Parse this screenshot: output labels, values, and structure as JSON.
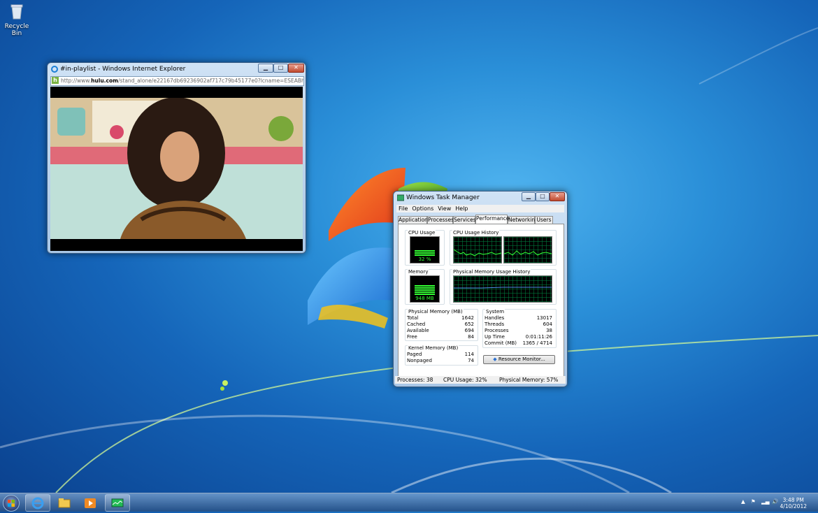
{
  "desktop": {
    "icons": [
      {
        "label": "Recycle Bin",
        "icon": "recycle-bin-icon"
      }
    ]
  },
  "ie_window": {
    "title": "#in-playlist - Windows Internet Explorer",
    "address_url_prefix": "http://www.",
    "address_url_domain": "hulu.com",
    "address_url_rest": "/stand_alone/e22167db69236902af717c79b45177e0?lcname=ESEABhVwb3BvdXRUaW",
    "site_icon": "h",
    "controls": {
      "minimize": "▁",
      "maximize": "□",
      "close": "✕"
    }
  },
  "task_manager": {
    "title": "Windows Task Manager",
    "menu": [
      "File",
      "Options",
      "View",
      "Help"
    ],
    "tabs": [
      "Applications",
      "Processes",
      "Services",
      "Performance",
      "Networking",
      "Users"
    ],
    "active_tab": "Performance",
    "cpu_usage_label": "CPU Usage",
    "cpu_usage_value": "32 %",
    "cpu_history_label": "CPU Usage History",
    "memory_label": "Memory",
    "memory_value": "948 MB",
    "mem_history_label": "Physical Memory Usage History",
    "physical_memory": {
      "title": "Physical Memory (MB)",
      "rows": [
        {
          "label": "Total",
          "value": "1642"
        },
        {
          "label": "Cached",
          "value": "652"
        },
        {
          "label": "Available",
          "value": "694"
        },
        {
          "label": "Free",
          "value": "84"
        }
      ]
    },
    "kernel_memory": {
      "title": "Kernel Memory (MB)",
      "rows": [
        {
          "label": "Paged",
          "value": "114"
        },
        {
          "label": "Nonpaged",
          "value": "74"
        }
      ]
    },
    "system": {
      "title": "System",
      "rows": [
        {
          "label": "Handles",
          "value": "13017"
        },
        {
          "label": "Threads",
          "value": "604"
        },
        {
          "label": "Processes",
          "value": "38"
        },
        {
          "label": "Up Time",
          "value": "0:01:11:26"
        },
        {
          "label": "Commit (MB)",
          "value": "1365 / 4714"
        }
      ]
    },
    "resource_monitor_button": "Resource Monitor...",
    "status": {
      "processes": "Processes: 38",
      "cpu": "CPU Usage: 32%",
      "memory": "Physical Memory: 57%"
    },
    "cpu_usage_fraction": 0.32,
    "memory_usage_fraction": 0.57
  },
  "taskbar": {
    "pinned": [
      "internet-explorer-icon",
      "windows-explorer-icon",
      "media-player-icon",
      "task-manager-icon"
    ],
    "tray_icons": [
      "show-hidden-icons-icon",
      "action-center-flag-icon",
      "network-signal-icon",
      "volume-icon"
    ],
    "clock_time": "3:48 PM",
    "clock_date": "4/10/2012"
  },
  "colors": {
    "desktop_blue": "#1d74c9",
    "meter_green": "#33ff33",
    "graph_grid": "#008040",
    "mem_history_line": "#4f8fe8"
  }
}
